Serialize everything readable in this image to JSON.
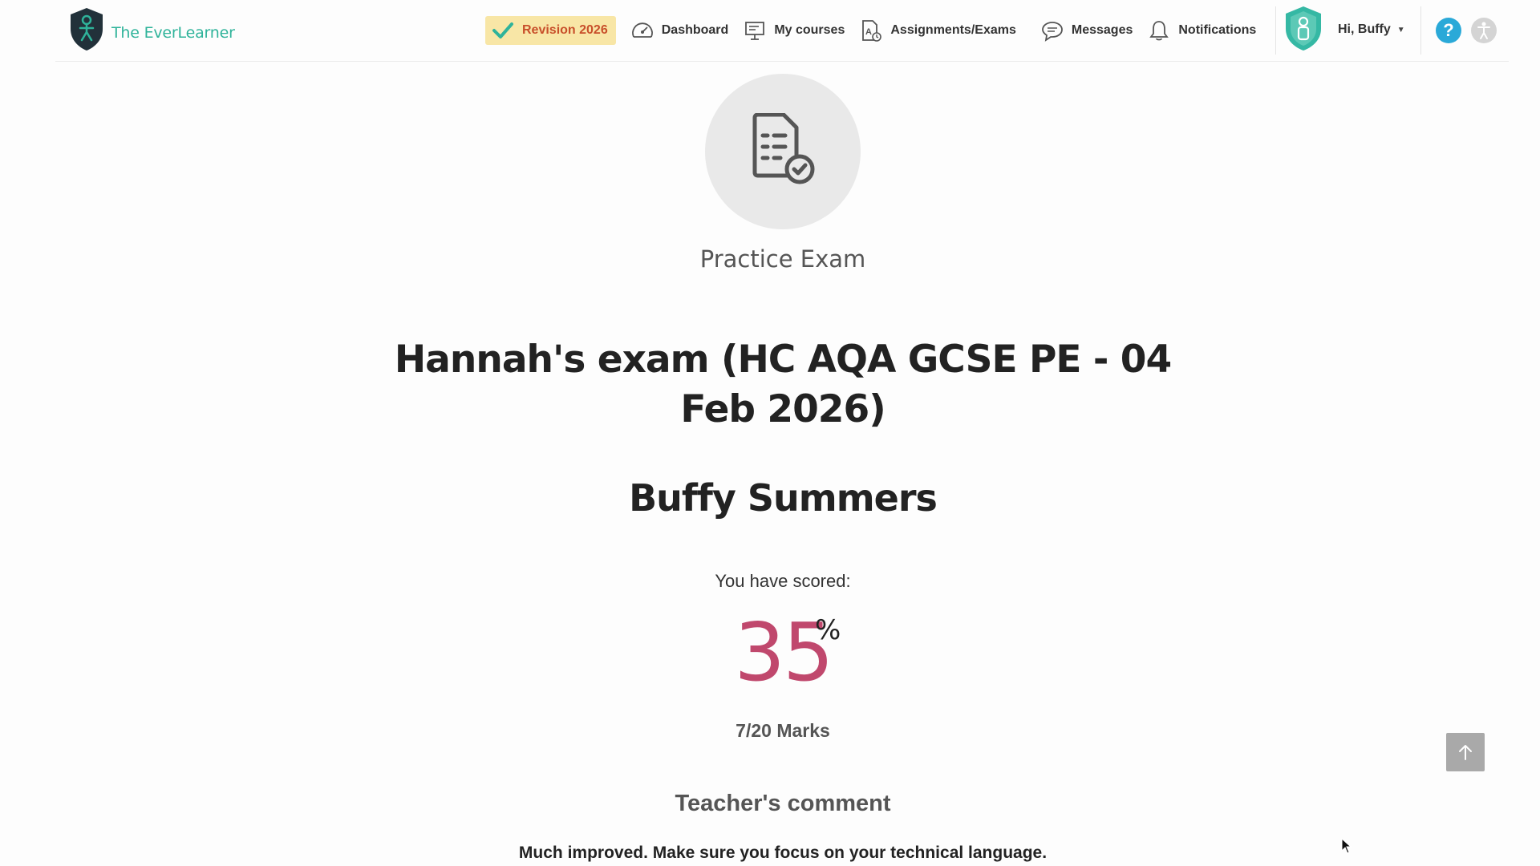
{
  "brand": {
    "name": "The EverLearner",
    "color": "#2fb39a"
  },
  "nav": {
    "revision_label": "Revision 2026",
    "items": [
      {
        "label": "Dashboard",
        "icon": "dashboard-gauge-icon"
      },
      {
        "label": "My courses",
        "icon": "presentation-board-icon"
      },
      {
        "label": "Assignments/Exams",
        "icon": "exam-document-icon"
      },
      {
        "label": "Messages",
        "icon": "speech-bubble-icon"
      },
      {
        "label": "Notifications",
        "icon": "bell-icon"
      }
    ],
    "greeting": "Hi, Buffy",
    "help_label": "?"
  },
  "exam": {
    "type": "Practice Exam",
    "title": "Hannah's exam (HC AQA GCSE PE - 04 Feb 2026)",
    "student_name": "Buffy Summers",
    "scored_label": "You have scored:",
    "score_value": "35",
    "score_unit": "%",
    "marks": "7/20 Marks",
    "score_color": "#c0486d"
  },
  "feedback": {
    "heading": "Teacher's comment",
    "comment": "Much improved. Make sure you focus on your technical language."
  }
}
